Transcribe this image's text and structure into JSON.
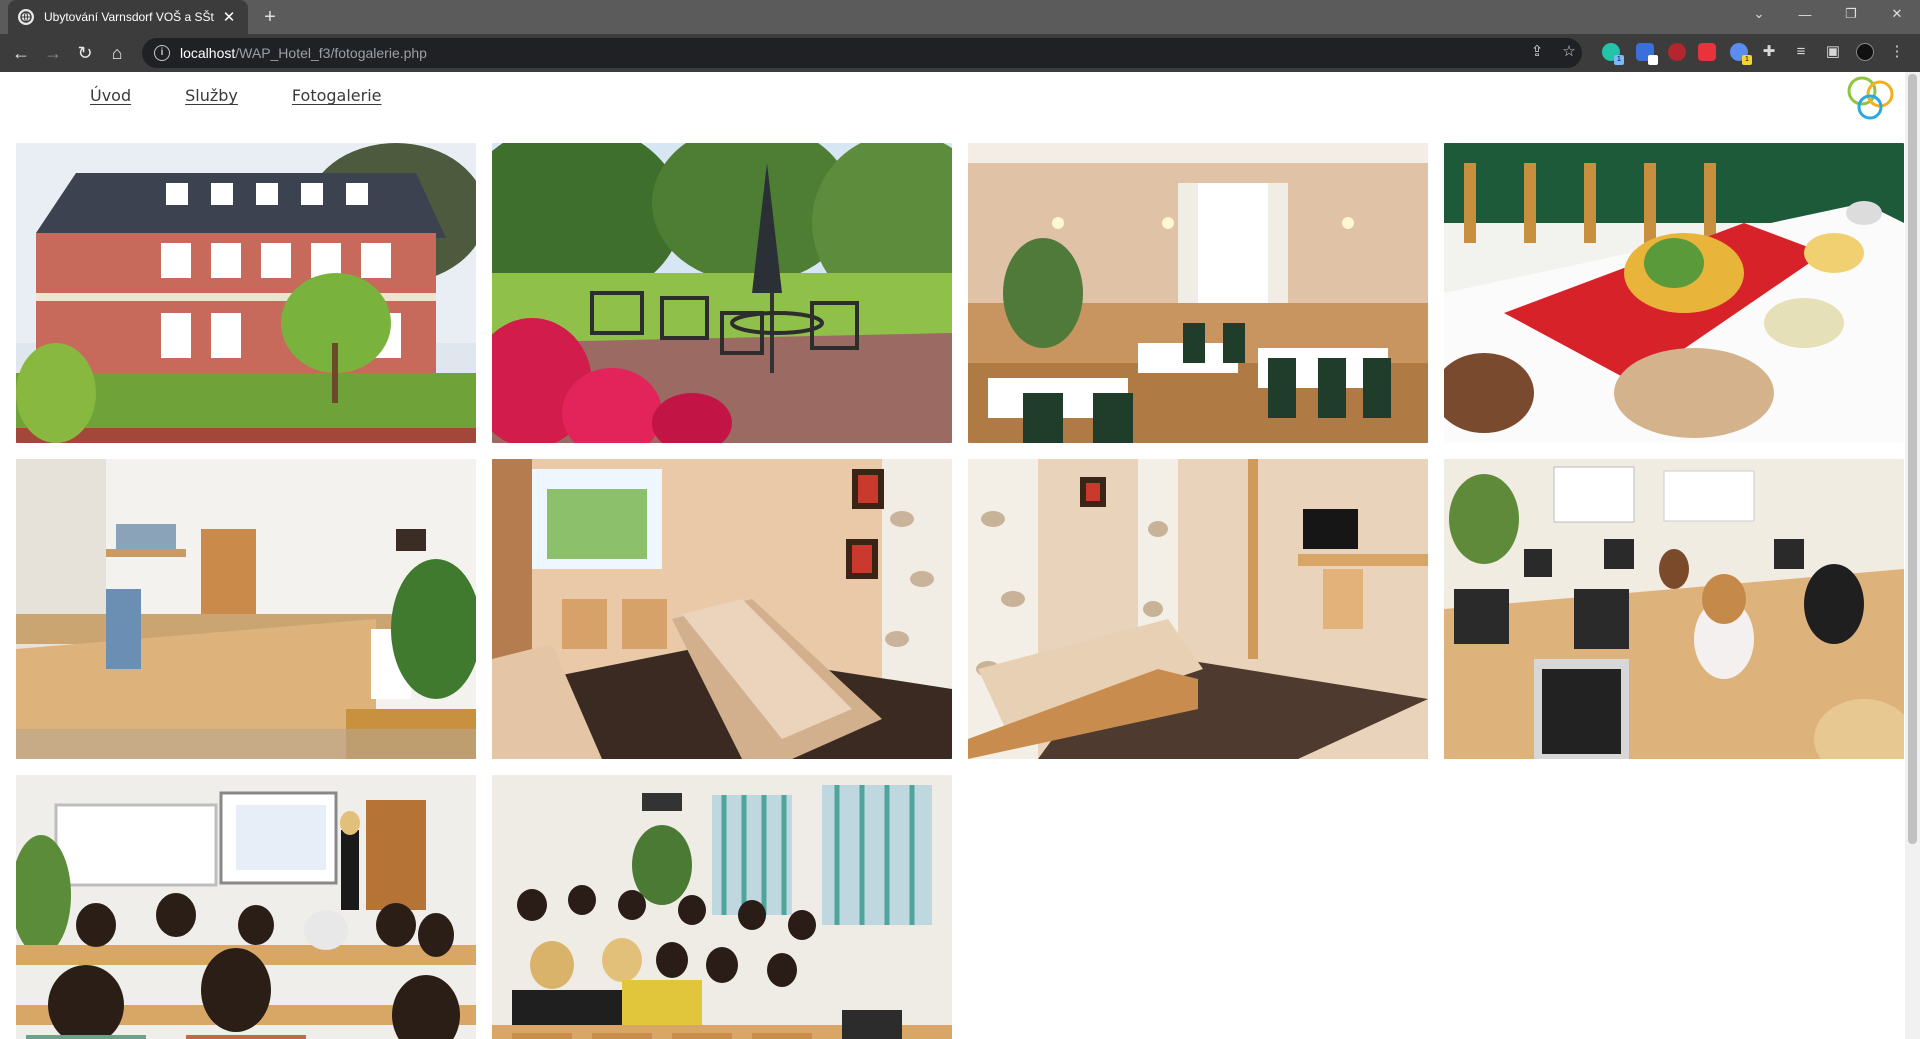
{
  "browser": {
    "tab_title": "Ubytování Varnsdorf VOŠ a SŠt",
    "tab_close": "✕",
    "new_tab": "+",
    "url_host": "localhost",
    "url_path": "/WAP_Hotel_f3/fotogalerie.php"
  },
  "nav": {
    "items": [
      {
        "label": "Úvod"
      },
      {
        "label": "Služby"
      },
      {
        "label": "Fotogalerie"
      }
    ]
  },
  "gallery": {
    "photos": [
      {
        "subject": "hotel building exterior"
      },
      {
        "subject": "garden terrace with parasol"
      },
      {
        "subject": "restaurant dining room"
      },
      {
        "subject": "buffet table"
      },
      {
        "subject": "reception desk"
      },
      {
        "subject": "twin bedroom"
      },
      {
        "subject": "bedroom with tv"
      },
      {
        "subject": "computer classroom"
      },
      {
        "subject": "lecture with presenter"
      },
      {
        "subject": "lecture hall audience"
      }
    ]
  },
  "colors": {
    "chrome_dark": "#3c3c3c",
    "chrome_tabbar": "#5b5b5b",
    "omnibox": "#202124",
    "nav_text": "#3a3a3a"
  }
}
